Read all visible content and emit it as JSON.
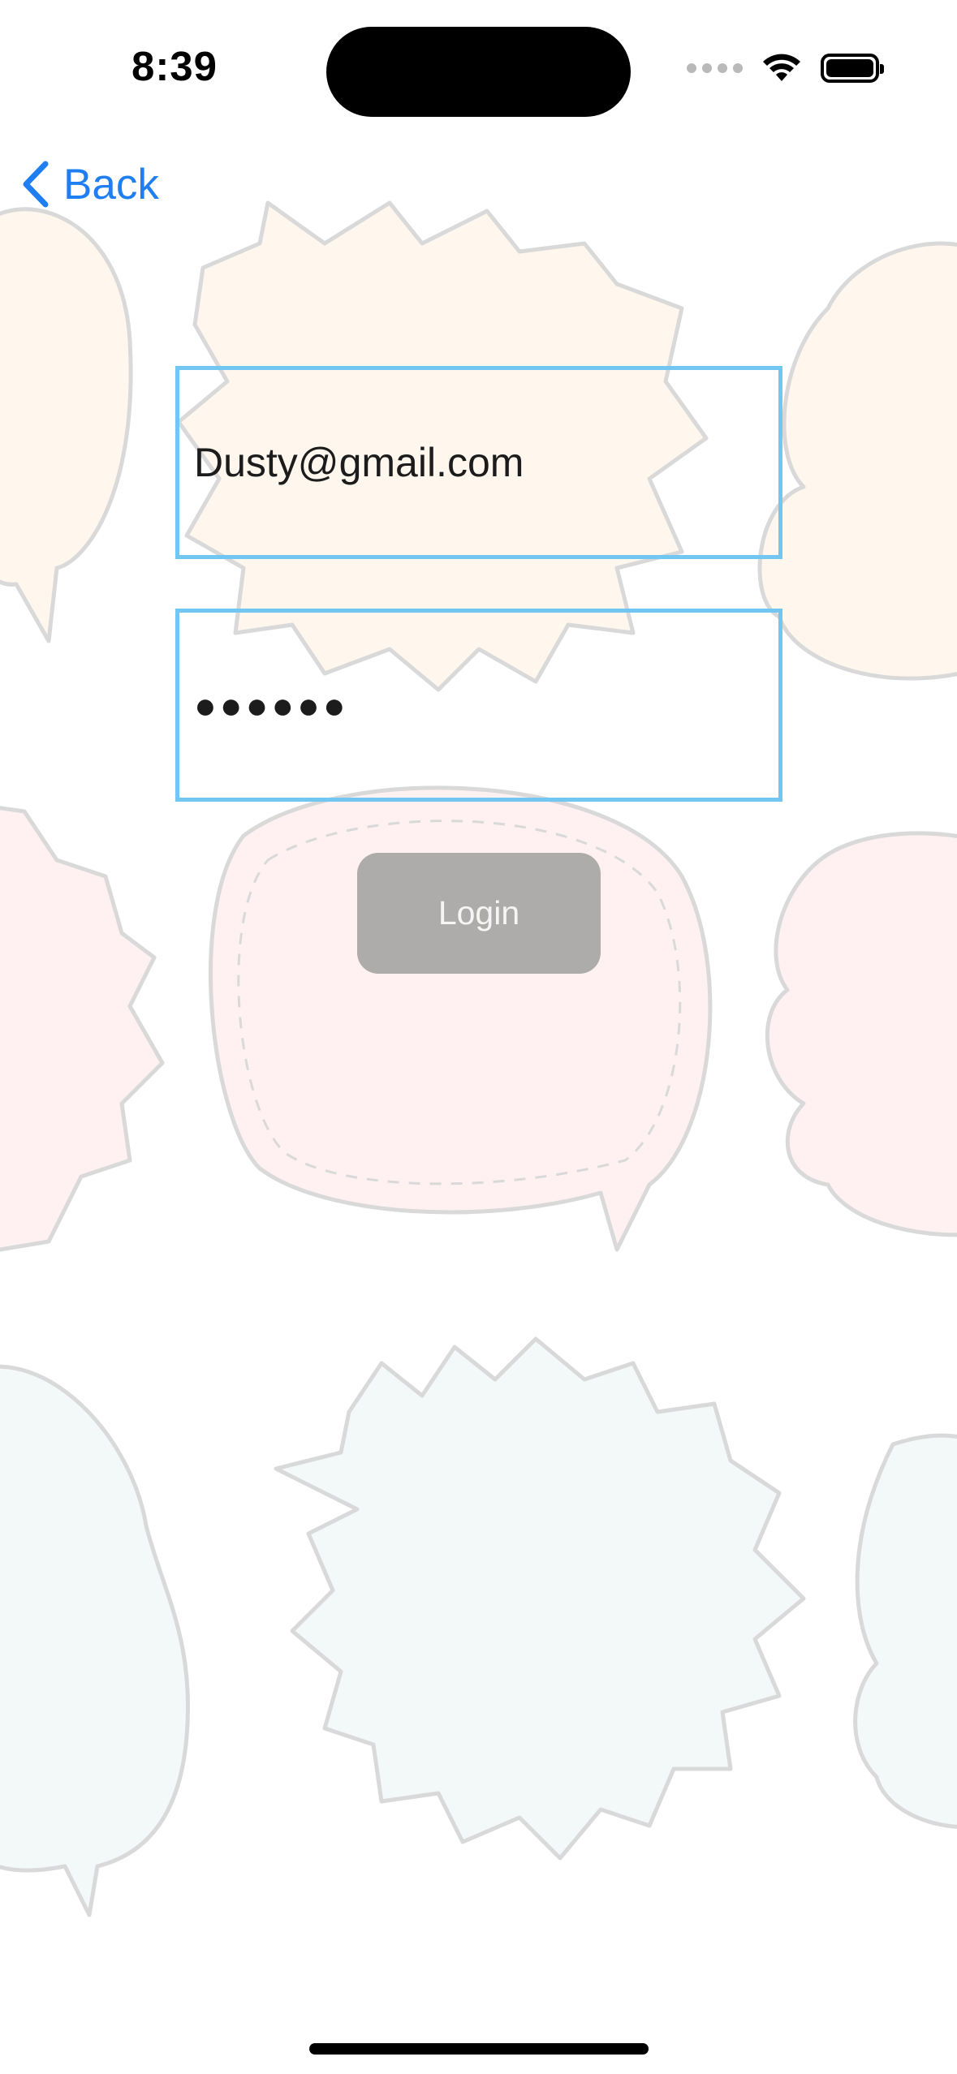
{
  "status_bar": {
    "time": "8:39"
  },
  "nav": {
    "back_label": "Back"
  },
  "form": {
    "email_value": "Dusty@gmail.com",
    "password_masked": "●●●●●●",
    "login_label": "Login"
  },
  "colors": {
    "accent": "#1e7ef2",
    "field_border": "#72c6f2",
    "button_disabled": "#aeabab"
  }
}
